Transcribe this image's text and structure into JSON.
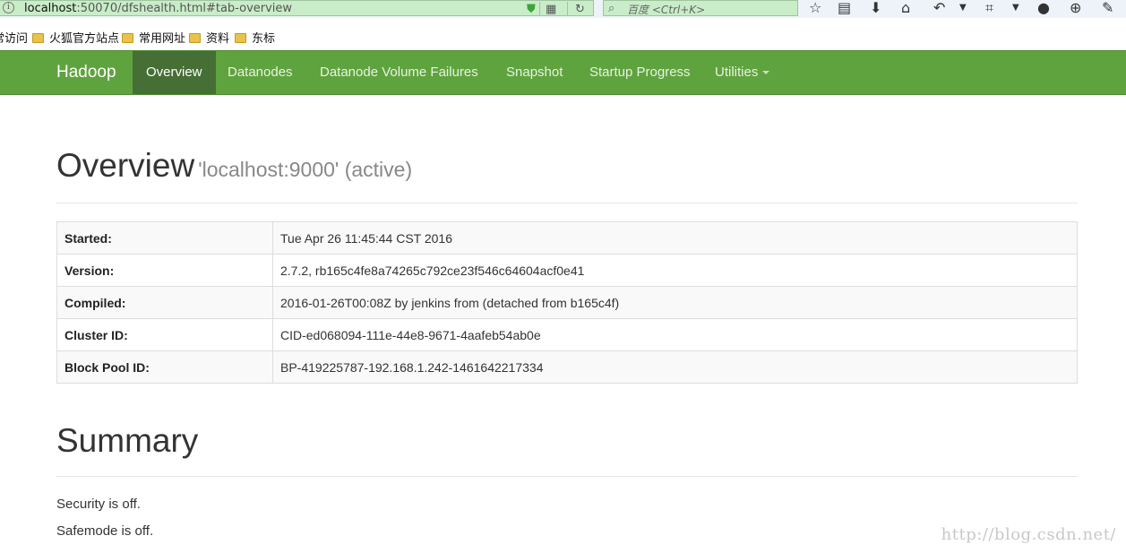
{
  "browser": {
    "url_host": "localhost",
    "url_rest": ":50070/dfshealth.html#tab-overview",
    "search_placeholder": "百度 <Ctrl+K>",
    "bookmarks": [
      "常访问",
      "火狐官方站点",
      "常用网址",
      "资料",
      "东标"
    ]
  },
  "navbar": {
    "brand": "Hadoop",
    "items": [
      "Overview",
      "Datanodes",
      "Datanode Volume Failures",
      "Snapshot",
      "Startup Progress",
      "Utilities"
    ],
    "active": "Overview"
  },
  "overview": {
    "title": "Overview",
    "subtitle": "'localhost:9000' (active)",
    "rows": [
      {
        "key": "Started:",
        "value": "Tue Apr 26 11:45:44 CST 2016"
      },
      {
        "key": "Version:",
        "value": "2.7.2, rb165c4fe8a74265c792ce23f546c64604acf0e41"
      },
      {
        "key": "Compiled:",
        "value": "2016-01-26T00:08Z by jenkins from (detached from b165c4f)"
      },
      {
        "key": "Cluster ID:",
        "value": "CID-ed068094-111e-44e8-9671-4aafeb54ab0e"
      },
      {
        "key": "Block Pool ID:",
        "value": "BP-419225787-192.168.1.242-1461642217334"
      }
    ]
  },
  "summary": {
    "title": "Summary",
    "lines": [
      "Security is off.",
      "Safemode is off."
    ]
  },
  "watermark": "http://blog.csdn.net/",
  "colors": {
    "navbar": "#5fa33e",
    "navbar_active": "#456f34"
  }
}
